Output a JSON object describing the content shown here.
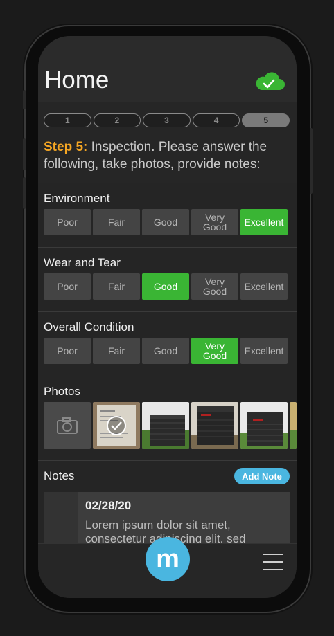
{
  "header": {
    "title": "Home",
    "sync_icon": "cloud-check-icon",
    "sync_color": "#3ab534"
  },
  "steps": [
    {
      "label": "1",
      "active": false
    },
    {
      "label": "2",
      "active": false
    },
    {
      "label": "3",
      "active": false
    },
    {
      "label": "4",
      "active": false
    },
    {
      "label": "5",
      "active": true
    }
  ],
  "intro": {
    "step_label": "Step 5:",
    "text": " Inspection. Please answer the following, take photos, provide notes:"
  },
  "sections": [
    {
      "title": "Environment",
      "options": [
        "Poor",
        "Fair",
        "Good",
        "Very\nGood",
        "Excellent"
      ],
      "selected": "Excellent"
    },
    {
      "title": "Wear and Tear",
      "options": [
        "Poor",
        "Fair",
        "Good",
        "Very\nGood",
        "Excellent"
      ],
      "selected": "Good"
    },
    {
      "title": "Overall Condition",
      "options": [
        "Poor",
        "Fair",
        "Good",
        "Very\nGood",
        "Excellent"
      ],
      "selected": "Very\nGood"
    }
  ],
  "photos": {
    "title": "Photos",
    "camera_icon": "camera-icon"
  },
  "notes": {
    "title": "Notes",
    "add_label": "Add Note",
    "items": [
      {
        "date": "02/28/20",
        "text": "Lorem ipsum dolor sit amet, consectetur adipiscing elit, sed"
      }
    ]
  },
  "bottom": {
    "logo": "m",
    "menu_icon": "hamburger-menu-icon"
  },
  "colors": {
    "accent_green": "#3ab534",
    "accent_blue": "#4ab6e0",
    "step_orange": "#f5a623"
  }
}
